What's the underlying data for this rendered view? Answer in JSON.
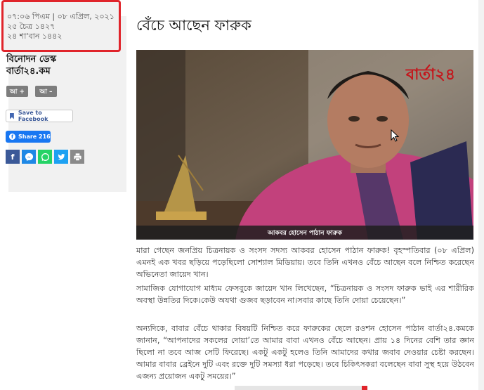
{
  "sidebar": {
    "datetime_line": "০৭:০৬ পিএম | ০৮ এপ্রিল, ২০২১",
    "bangla_date": "২৫ চৈত্র ১৪২৭",
    "hijri_date": "২৪ শা'বান ১৪৪২",
    "author_line1": "বিনোদন ডেস্ক",
    "author_line2": "বার্তা২৪.কম",
    "font_increase": "আ +",
    "font_decrease": "আ –",
    "save_facebook": "Save to Facebook",
    "share_label": "Share 216",
    "social_icons": [
      "facebook-icon",
      "messenger-icon",
      "whatsapp-icon",
      "twitter-icon",
      "print-icon"
    ]
  },
  "article": {
    "headline": "বেঁচে আছেন ফারুক",
    "photo_brand": "বার্তা২৪",
    "photo_caption": "আকবর হোসেন পাঠান ফারুক",
    "paragraphs": [
      "মারা গেছেন জনপ্রিয় চিত্রনায়ক ও সংসদ সদস্য আকবর হোসেন পাঠান ফারুক! বৃহস্পতিবার (০৮ এপ্রিল) এমনই এক খবর ছড়িয়ে পড়েছিলো সোশ্যাল মিডিয়ায়। তবে তিনি এখনও বেঁচে আছেন বলে নিশ্চিত করেছেন অভিনেতা জায়েদ খান।",
      "সামাজিক যোগাযোগ মাধ্যম ফেসবুকে জায়েদ খান লিখেছেন, “চিত্রনায়ক ও সংসদ ফারুক ভাই এর শারীরিক অবস্থা উন্নতির দিকে।কেউ অযথা গুজব ছড়াবেন না।সবার কাছে তিনি দোয়া চেয়েছেন।”",
      "অন্যদিকে, বাবার বেঁচে থাকার বিষয়টি নিশ্চিত করে ফারুকের ছেলে রওশন হোসেন পাঠান বার্তা২৪.কমকে জানান, “আপনাদের সকলের দোয়া’তে আমার বাবা এখনও বেঁচে আছেন। প্রায় ১৪ দিনের বেশি তার জ্ঞান ছিলো না তবে আজ সেটি ফিরেছে। একটু একটু হলেও তিনি আমাদের কথার জবাব দেওয়ার চেষ্টা করছেন। আমার বাবার ব্রেইনে দুটি এবং রক্তে দুটি সমস্যা ধরা পড়েছে। তবে চিকিৎসকরা বলেছেন বাবা সুস্থ হয়ে উঠবেন এজন্য প্রয়োজন একটু সময়ের।”"
    ]
  },
  "colors": {
    "highlight_border": "#e0242b",
    "facebook": "#3b5998",
    "messenger": "#1e88e5",
    "whatsapp": "#25d366",
    "twitter": "#1da1f2",
    "print": "#8a8a8a"
  }
}
